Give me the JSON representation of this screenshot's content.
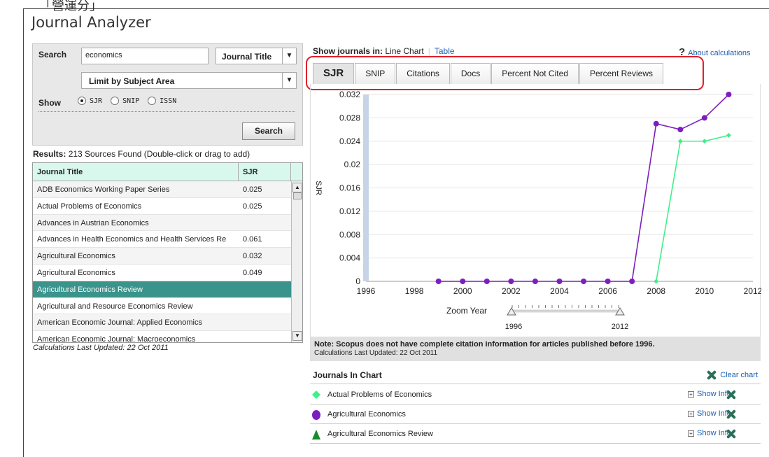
{
  "page": {
    "top_fragment": "「營運分」",
    "app_title": "Journal Analyzer"
  },
  "search": {
    "label": "Search",
    "value": "economics",
    "type_select": "Journal Title",
    "subject_select": "Limit by Subject Area",
    "show_label": "Show",
    "options": [
      "SJR",
      "SNIP",
      "ISSN"
    ],
    "selected": "SJR",
    "button": "Search"
  },
  "results": {
    "label": "Results:",
    "summary": "213 Sources Found (Double-click or drag to add)",
    "columns": [
      "Journal Title",
      "SJR"
    ],
    "rows": [
      {
        "title": "ADB Economics Working Paper Series",
        "sjr": "0.025"
      },
      {
        "title": "Actual Problems of Economics",
        "sjr": "0.025"
      },
      {
        "title": "Advances in Austrian Economics",
        "sjr": ""
      },
      {
        "title": "Advances in Health Economics and Health Services Re",
        "sjr": "0.061"
      },
      {
        "title": "Agricultural Economics",
        "sjr": "0.032"
      },
      {
        "title": "Agricultural Economics",
        "sjr": "0.049"
      },
      {
        "title": "Agricultural Economics Review",
        "sjr": ""
      },
      {
        "title": "Agricultural and Resource Economics Review",
        "sjr": ""
      },
      {
        "title": "American Economic Journal: Applied Economics",
        "sjr": ""
      },
      {
        "title": "American Economic Journal: Macroeconomics",
        "sjr": ""
      }
    ],
    "selected_index": 6,
    "last_updated": "Calculations Last Updated: 22 Oct 2011"
  },
  "view": {
    "show_label": "Show journals in:",
    "current": "Line Chart",
    "alt": "Table",
    "about": "About calculations",
    "tabs": [
      "SJR",
      "SNIP",
      "Citations",
      "Docs",
      "Percent Not Cited",
      "Percent Reviews"
    ],
    "active_tab": "SJR"
  },
  "zoom": {
    "label": "Zoom Year",
    "start": "1996",
    "end": "2012"
  },
  "chart_data": {
    "type": "line",
    "ylabel": "SJR",
    "xlabel": "",
    "xlim": [
      1996,
      2012
    ],
    "ylim": [
      0,
      0.032
    ],
    "x_ticks": [
      "1996",
      "1998",
      "2000",
      "2002",
      "2004",
      "2006",
      "2008",
      "2010",
      "2012"
    ],
    "y_ticks": [
      "0",
      "0.004",
      "0.008",
      "0.012",
      "0.016",
      "0.02",
      "0.024",
      "0.028",
      "0.032"
    ],
    "series": [
      {
        "name": "Agricultural Economics",
        "color": "#7d1fbf",
        "marker": "circle",
        "x": [
          1999,
          2000,
          2001,
          2002,
          2003,
          2004,
          2005,
          2006,
          2007,
          2008,
          2009,
          2010,
          2011
        ],
        "y": [
          0,
          0,
          0,
          0,
          0,
          0,
          0,
          0,
          0,
          0.027,
          0.026,
          0.028,
          0.032
        ]
      },
      {
        "name": "Actual Problems of Economics",
        "color": "#3ef08a",
        "marker": "diamond",
        "x": [
          2008,
          2009,
          2010,
          2011
        ],
        "y": [
          0,
          0.024,
          0.024,
          0.025
        ]
      }
    ]
  },
  "note": {
    "bold": "Note: Scopus does not have complete citation information for articles published before 1996.",
    "small": "Calculations Last Updated: 22 Oct 2011"
  },
  "journals_in_chart": {
    "title": "Journals In Chart",
    "clear": "Clear chart",
    "show_info": "Show Info",
    "items": [
      {
        "name": "Actual Problems of Economics",
        "marker": "diamond",
        "color": "#3ef08a"
      },
      {
        "name": "Agricultural Economics",
        "marker": "circle",
        "color": "#7d1fbf"
      },
      {
        "name": "Agricultural Economics Review",
        "marker": "triangle",
        "color": "#1a8a2a"
      }
    ]
  }
}
